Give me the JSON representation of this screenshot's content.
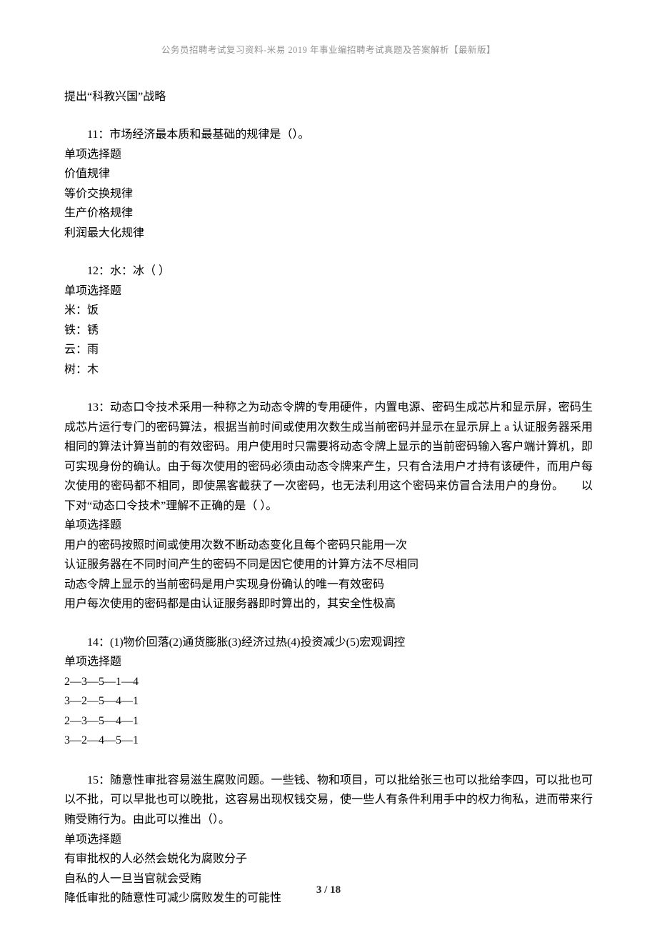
{
  "header": "公务员招聘考试复习资料-米易 2019 年事业编招聘考试真题及答案解析【最新版】",
  "prelude": "提出“科教兴国”战略",
  "q11": {
    "stem": "11：市场经济最本质和最基础的规律是（）。",
    "type": "单项选择题",
    "opts": [
      "价值规律",
      "等价交换规律",
      "生产价格规律",
      "利润最大化规律"
    ]
  },
  "q12": {
    "stem": "12：水：冰（ ）",
    "type": "单项选择题",
    "opts": [
      "米：饭",
      "铁：锈",
      "云：雨",
      "树：木"
    ]
  },
  "q13": {
    "stem": "13：动态口令技术采用一种称之为动态令牌的专用硬件，内置电源、密码生成芯片和显示屏，密码生成芯片运行专门的密码算法，根据当前时间或使用次数生成当前密码并显示在显示屏上 a 认证服务器采用相同的算法计算当前的有效密码。用户使用时只需要将动态令牌上显示的当前密码输入客户端计算机，即可实现身份的确认。由于每次使用的密码必须由动态令牌来产生，只有合法用户才持有该硬件，而用户每次使用的密码都不相同，即使黑客截获了一次密码，也无法利用这个密码来仿冒合法用户的身份。　　以下对“动态口令技术”理解不正确的是（  ）。",
    "type": "单项选择题",
    "opts": [
      "用户的密码按照时间或使用次数不断动态变化且每个密码只能用一次",
      "认证服务器在不同时间产生的密码不同是因它使用的计算方法不尽相同",
      "动态令牌上显示的当前密码是用户实现身份确认的唯一有效密码",
      "用户每次使用的密码都是由认证服务器即时算出的，其安全性极高"
    ]
  },
  "q14": {
    "stem": "14：(1)物价回落(2)通货膨胀(3)经济过热(4)投资减少(5)宏观调控",
    "type": "单项选择题",
    "opts": [
      "2—3—5—1—4",
      "3—2—5—4—1",
      "2—3—5—4—1",
      "3—2—4—5—1"
    ]
  },
  "q15": {
    "stem": "15：随意性审批容易滋生腐败问题。一些钱、物和项目，可以批给张三也可以批给李四，可以批也可以不批，可以早批也可以晚批，这容易出现权钱交易，使一些人有条件利用手中的权力徇私，进而带来行贿受贿行为。由此可以推出（）。",
    "type": "单项选择题",
    "opts": [
      "有审批权的人必然会蜕化为腐败分子",
      "自私的人一旦当官就会受贿",
      "降低审批的随意性可减少腐败发生的可能性"
    ]
  },
  "pageNumber": "3 / 18"
}
